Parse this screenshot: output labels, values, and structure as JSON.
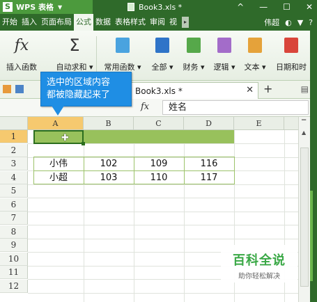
{
  "titlebar": {
    "app_logo": "S",
    "app_name": "WPS 表格",
    "doc_title": "Book3.xls *",
    "window_controls": [
      "^",
      "—",
      "☐",
      "✕"
    ]
  },
  "menu": {
    "tabs": [
      "开始",
      "插入",
      "页面布局",
      "公式",
      "数据",
      "表格样式",
      "审阅",
      "视"
    ],
    "active": "公式",
    "user": "伟超",
    "icons_right": [
      "skin-icon",
      "shirt-icon",
      "help-icon"
    ]
  },
  "ribbon": {
    "buttons": [
      {
        "label": "插入函数",
        "icon": "fx-icon"
      },
      {
        "label": "自动求和",
        "icon": "sigma-icon"
      },
      {
        "label": "常用函数",
        "icon": "function-book-icon",
        "color": "#4aa3df"
      },
      {
        "label": "全部",
        "icon": "all-book-icon",
        "color": "#2f74c8"
      },
      {
        "label": "财务",
        "icon": "finance-book-icon",
        "color": "#56a84a"
      },
      {
        "label": "逻辑",
        "icon": "logic-book-icon",
        "color": "#a36cc9"
      },
      {
        "label": "文本",
        "icon": "text-book-icon",
        "color": "#e5a23a"
      },
      {
        "label": "日期和时",
        "icon": "clock-book-icon",
        "color": "#d9453b"
      }
    ]
  },
  "tabstrip": {
    "sheet_tab": "Book3.xls *",
    "close": "✕",
    "new_tab": "+"
  },
  "formula_bar": {
    "fx": "fx",
    "value": "姓名"
  },
  "tooltip": {
    "line1": "选中的区域内容",
    "line2": "都被隐藏起来了"
  },
  "sheet": {
    "columns": [
      "A",
      "B",
      "C",
      "D",
      "E"
    ],
    "rows": [
      "1",
      "2",
      "3",
      "4",
      "5",
      "6",
      "7",
      "8",
      "9",
      "10",
      "11",
      "12"
    ],
    "data": [
      {
        "row": 3,
        "name": "小伟",
        "b": "102",
        "c": "109",
        "d": "116"
      },
      {
        "row": 4,
        "name": "小超",
        "b": "103",
        "c": "110",
        "d": "117"
      }
    ],
    "highlight_color": "#98c15c",
    "selected_cell": "A1"
  },
  "watermark": {
    "title": "百科全说",
    "subtitle": "助你轻松解决"
  }
}
